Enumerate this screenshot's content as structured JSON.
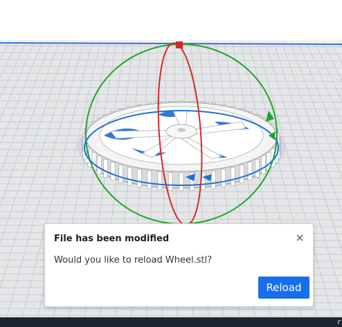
{
  "viewport": {
    "colors": {
      "background": "#eef0f2",
      "grid_line": "#c8cbcf",
      "build_plate_edge": "#3a6fd8",
      "model_fill": "#f4f4f4",
      "model_shadow": "#2f78e0",
      "rotate_x": "#d62828",
      "rotate_y": "#1ea32a",
      "rotate_z": "#1f6fd6"
    },
    "model_icon": "gear-wheel-model",
    "gizmo_icon": "rotate-gizmo"
  },
  "dialog": {
    "title": "File has been modified",
    "message": "Would you like to reload Wheel.stl?",
    "reload_label": "Reload",
    "close_icon": "close-icon",
    "accent": "#196ef0"
  },
  "corner_text": "r"
}
